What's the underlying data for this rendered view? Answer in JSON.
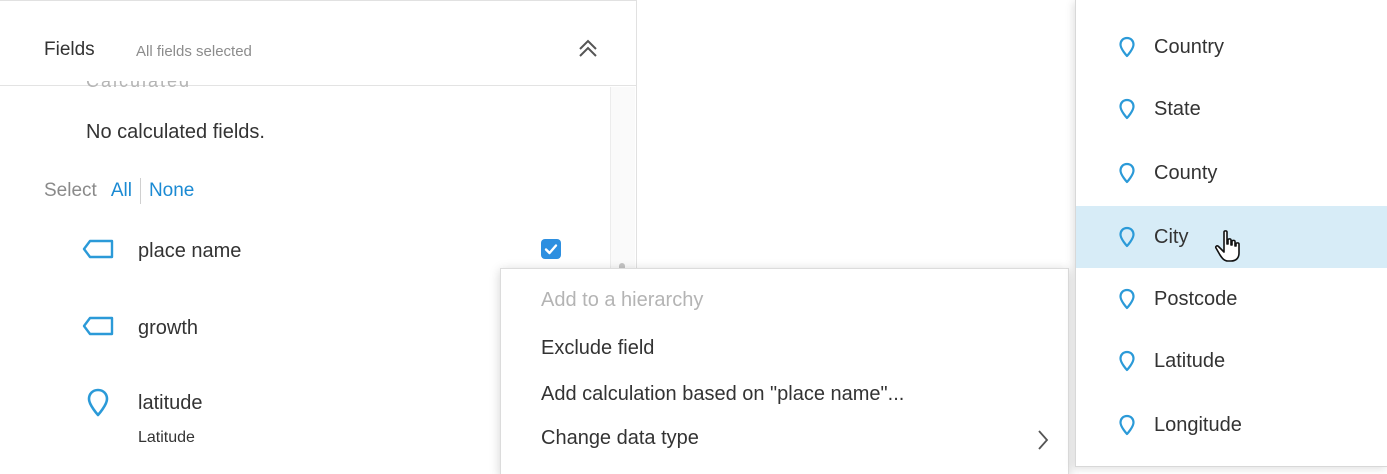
{
  "fields_panel": {
    "title": "Fields",
    "subtitle": "All fields selected",
    "cut_text": "Calculated fields",
    "empty_calculated": "No calculated fields.",
    "select": {
      "label": "Select",
      "all": "All",
      "none": "None"
    },
    "fields": [
      {
        "name": "place name",
        "icon": "dimension-tag-icon",
        "checked": true
      },
      {
        "name": "growth",
        "icon": "dimension-tag-icon"
      },
      {
        "name": "latitude",
        "icon": "map-pin-icon",
        "geo_role": "Latitude"
      }
    ]
  },
  "context_menu": {
    "items": [
      {
        "label": "Add to a hierarchy",
        "disabled": true
      },
      {
        "label": "Exclude field"
      },
      {
        "label": "Add calculation based on \"place name\"..."
      },
      {
        "label": "Change data type",
        "has_submenu": true
      }
    ]
  },
  "geo_menu": {
    "items": [
      {
        "label": "Country"
      },
      {
        "label": "State"
      },
      {
        "label": "County"
      },
      {
        "label": "City",
        "selected": true
      },
      {
        "label": "Postcode"
      },
      {
        "label": "Latitude"
      },
      {
        "label": "Longitude"
      }
    ]
  },
  "colors": {
    "accent": "#1b8ad3",
    "icon": "#2b9ad8",
    "selected_bg": "#d7ecf7",
    "checkbox": "#2d8fe0",
    "disabled_text": "#b4b4b4"
  }
}
